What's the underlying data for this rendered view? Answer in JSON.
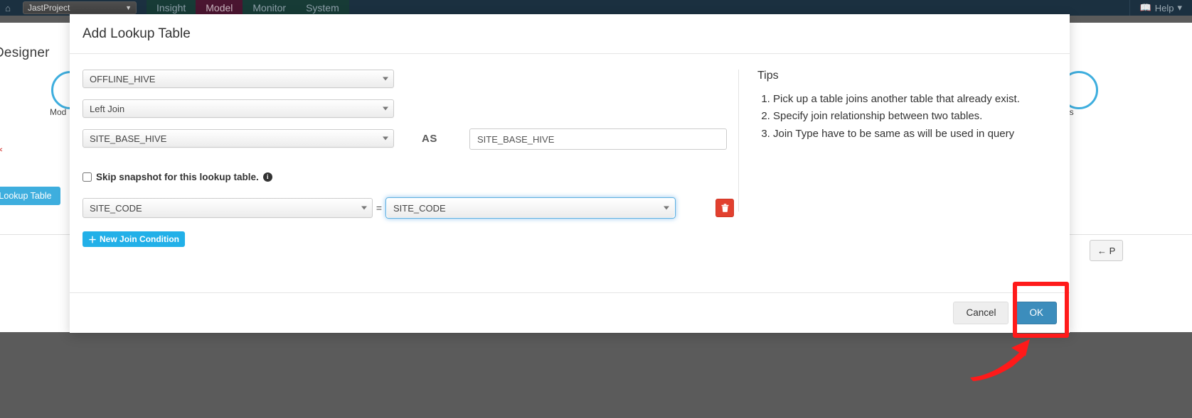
{
  "navbar": {
    "home_icon": "home-icon",
    "project_select": {
      "value": "JastProject",
      "caret": "▼"
    },
    "tabs": [
      {
        "label": "Insight",
        "active": false
      },
      {
        "label": "Model",
        "active": true
      },
      {
        "label": "Monitor",
        "active": false
      },
      {
        "label": "System",
        "active": false
      }
    ],
    "help": {
      "label": "Help",
      "icon": "book-icon",
      "caret": "▾"
    }
  },
  "background_page": {
    "title": "Designer",
    "step_model_label": "Mod",
    "step_right_label": "gs",
    "required_mark": "∗",
    "lookup_button": "d Lookup Table",
    "prev_button": "← P"
  },
  "modal": {
    "title": "Add Lookup Table",
    "form": {
      "source_select": {
        "value": "OFFLINE_HIVE",
        "caret": "▼"
      },
      "join_type_select": {
        "value": "Left Join",
        "caret": "▼"
      },
      "table_select": {
        "value": "SITE_BASE_HIVE",
        "caret": "▼"
      },
      "as_label": "AS",
      "alias_input": {
        "value": "SITE_BASE_HIVE",
        "placeholder": ""
      },
      "skip_snapshot": {
        "checked": false,
        "label": "Skip snapshot for this lookup table.",
        "info_icon": "info-circle-icon",
        "info_glyph": "i"
      },
      "join_condition": {
        "left_select": {
          "value": "SITE_CODE",
          "caret": "▼"
        },
        "operator": "=",
        "right_select": {
          "value": "SITE_CODE",
          "caret": "▼",
          "focused": true
        },
        "delete_icon": "trash-icon"
      },
      "new_condition_button": {
        "label": "New Join Condition",
        "plus": "＋"
      }
    },
    "tips": {
      "title": "Tips",
      "items": [
        "Pick up a table joins another table that already exist.",
        "Specify join relationship between two tables.",
        "Join Type have to be same as will be used in query"
      ]
    },
    "footer": {
      "cancel_label": "Cancel",
      "ok_label": "OK"
    }
  },
  "annotations": {
    "highlight_color": "#ff1a1a",
    "highlight_target": "ok-button",
    "arrow_color": "#ff1a1a"
  },
  "colors": {
    "navbar_bg": "#1b3040",
    "nav_active_bg": "#4a1530",
    "primary_button": "#3c8dbc",
    "info_button": "#22b0e8",
    "danger_button": "#e2402f",
    "focus_ring": "#66afe9"
  }
}
